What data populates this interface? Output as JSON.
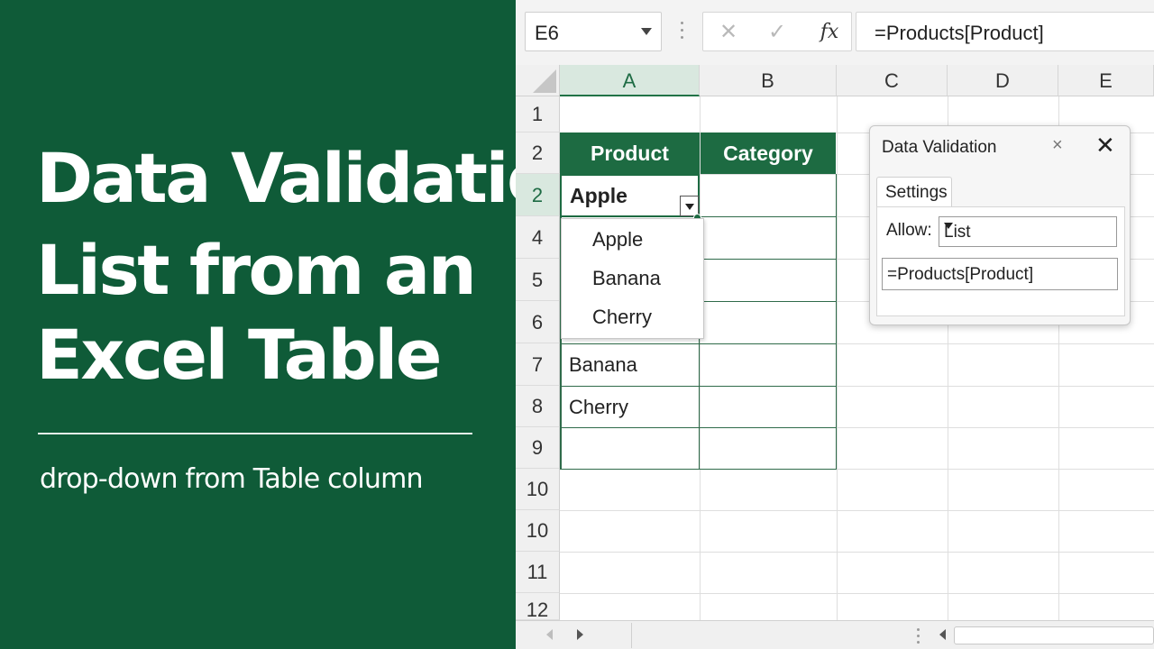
{
  "hero": {
    "title_lines": [
      "Data Validation",
      "List from an",
      "Excel Table"
    ],
    "subtitle": "drop-down from Table column"
  },
  "colors": {
    "panel_green": "#0f5b38",
    "table_header_green": "#1d6b42",
    "selected_header": "#d9e8df"
  },
  "formula_bar": {
    "name_box": "E6",
    "cancel_icon": "✕",
    "enter_icon": "✓",
    "fx_label": "fx",
    "formula": "=Products[Product]"
  },
  "grid": {
    "columns": [
      "A",
      "B",
      "C",
      "D",
      "E"
    ],
    "rows": [
      "1",
      "2",
      "2",
      "4",
      "5",
      "6",
      "7",
      "8",
      "9",
      "10",
      "10",
      "11",
      "12"
    ]
  },
  "table": {
    "headers": [
      "Product",
      "Category"
    ],
    "active_cell_value": "Apple",
    "cells": [
      "Banana",
      "Cherry"
    ]
  },
  "dropdown": {
    "options": [
      "Apple",
      "Banana",
      "Cherry"
    ]
  },
  "dialog": {
    "title": "Data Validation",
    "tab": "Settings",
    "allow_label": "Allow:",
    "allow_value": "List",
    "source": "=Products[Product]",
    "close_small": "×",
    "close_icon": "✕"
  }
}
